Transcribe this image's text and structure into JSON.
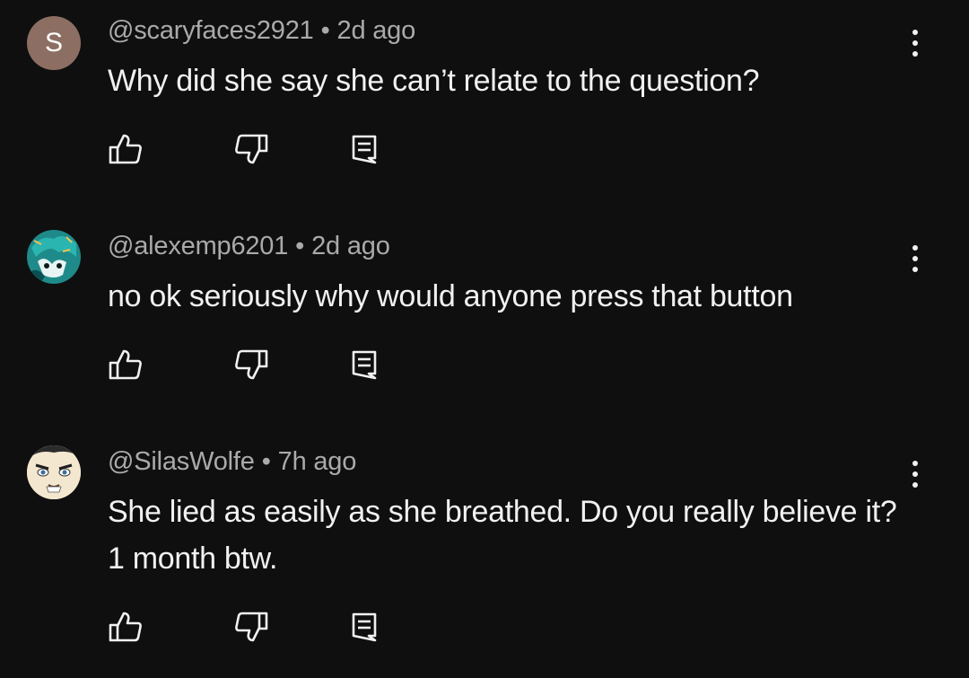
{
  "comments": [
    {
      "avatar_letter": "S",
      "avatar_color": "#8d6e63",
      "handle": "@scaryfaces2921",
      "time": "2d ago",
      "text": "Why did she say she can’t relate to the question?"
    },
    {
      "avatar_letter": "",
      "handle": "@alexemp6201",
      "time": "2d ago",
      "text": "no ok seriously why would anyone press that button"
    },
    {
      "avatar_letter": "",
      "handle": "@SilasWolfe",
      "time": "7h ago",
      "text": "She lied as easily as she breathed. Do you really believe it? 1 month btw."
    }
  ],
  "separator": "•",
  "icons": [
    "like-icon",
    "dislike-icon",
    "reply-icon",
    "more-vert-icon"
  ],
  "colors": {
    "background": "#0f0f0f",
    "text": "#f1f1f1",
    "meta": "#aaaaaa"
  }
}
